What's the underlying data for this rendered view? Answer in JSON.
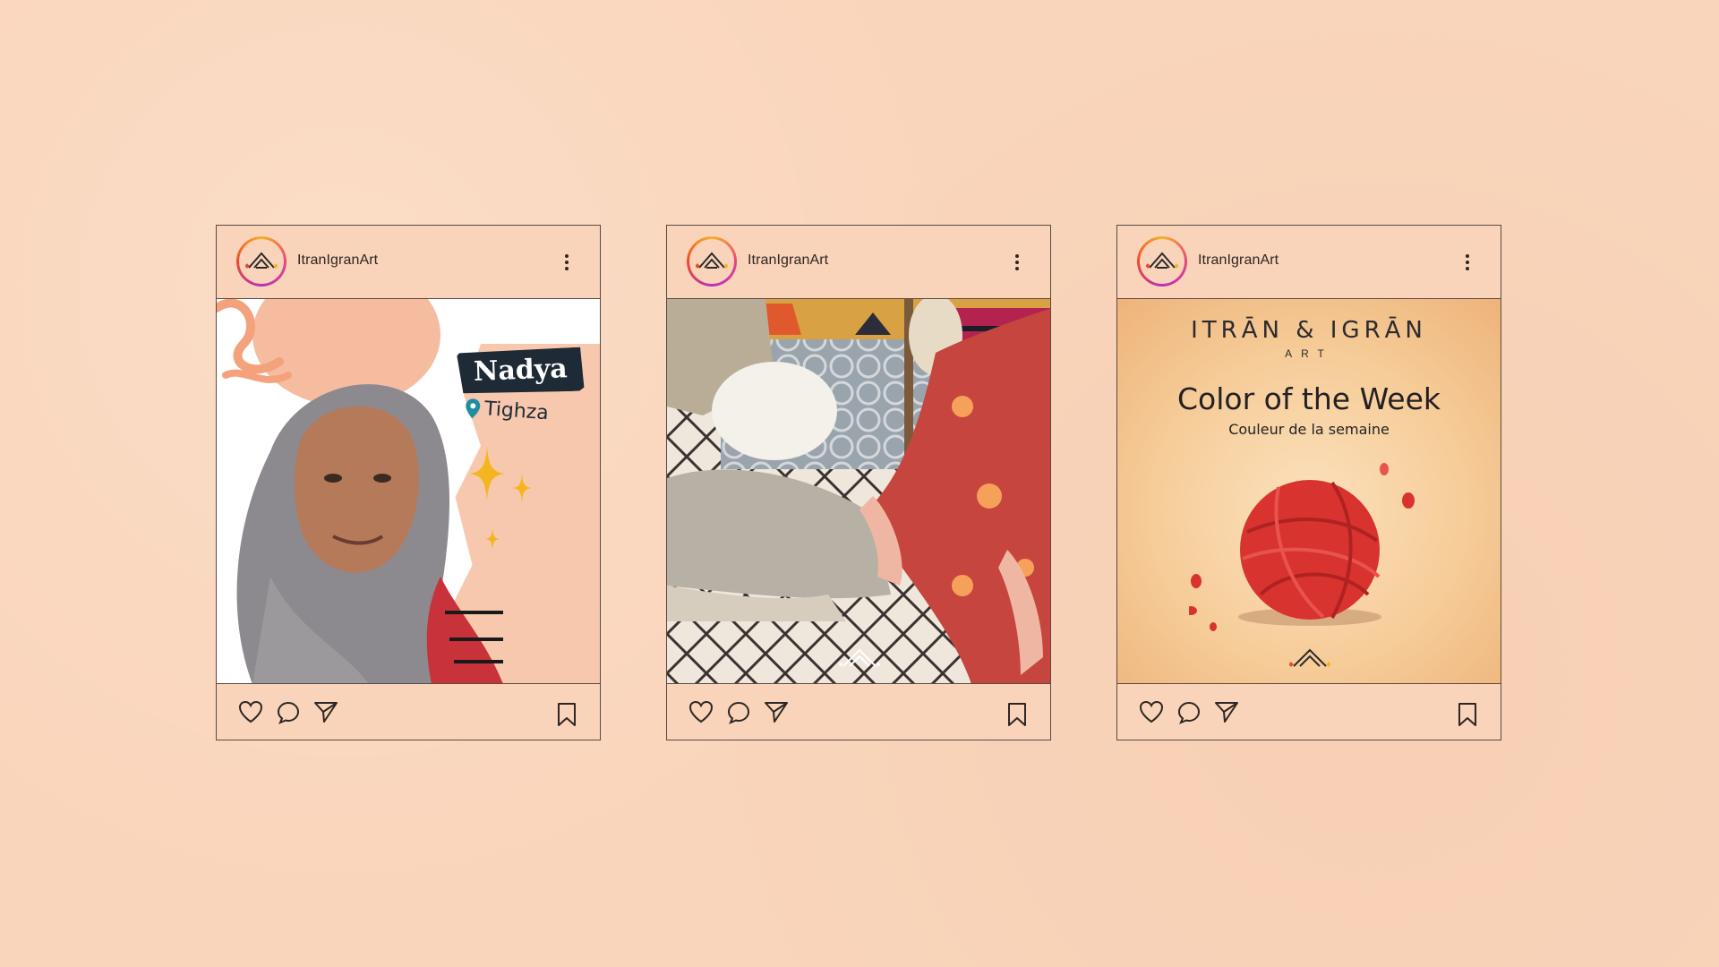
{
  "colors": {
    "background": "#f9d5bb",
    "border": "#5a4a42",
    "tag_bg": "#1e2a36",
    "yarn": "#d8332f",
    "sparkle": "#f5b521"
  },
  "posts": [
    {
      "username": "ItranIgranArt",
      "image": {
        "name": "Nadya",
        "location": "Tighza"
      }
    },
    {
      "username": "ItranIgranArt",
      "image": {}
    },
    {
      "username": "ItranIgranArt",
      "image": {
        "brand_title": "ITRĀN & IGRĀN",
        "brand_sub": "ART",
        "headline": "Color of the Week",
        "subheadline": "Couleur de la semaine"
      }
    }
  ],
  "icons": {
    "like": "heart-icon",
    "comment": "comment-icon",
    "share": "send-icon",
    "save": "bookmark-icon",
    "menu": "more-vertical-icon"
  }
}
